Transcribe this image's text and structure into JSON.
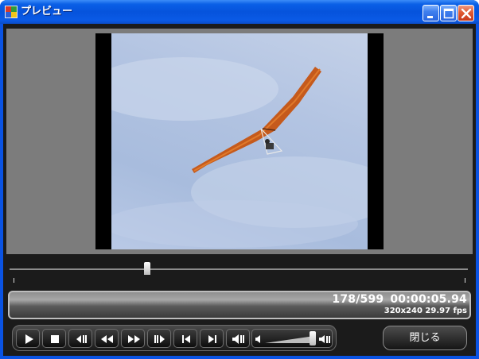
{
  "window": {
    "title": "プレビュー",
    "colors": {
      "titlebar": "#0653dc",
      "close_button": "#e05a32",
      "client_bg": "#1b1b1b",
      "preview_bg": "#7c7c7c"
    },
    "controls": {
      "minimize_icon": "minimize-icon",
      "maximize_icon": "maximize-icon",
      "close_icon": "close-icon"
    }
  },
  "playback": {
    "frame": "178/599",
    "timecode": "00:00:05.94",
    "video_info": "320x240 29.97 fps",
    "seek_position": 0.297,
    "volume_level": 0.78
  },
  "transport": {
    "buttons": [
      {
        "name": "play-button",
        "icon": "play-icon"
      },
      {
        "name": "stop-button",
        "icon": "stop-icon"
      },
      {
        "name": "step-back-button",
        "icon": "frame-back-icon"
      },
      {
        "name": "rewind-button",
        "icon": "rewind-icon"
      },
      {
        "name": "fast-forward-button",
        "icon": "fast-forward-icon"
      },
      {
        "name": "step-forward-button",
        "icon": "frame-forward-icon"
      },
      {
        "name": "go-to-start-button",
        "icon": "skip-start-icon"
      },
      {
        "name": "go-to-end-button",
        "icon": "skip-end-icon"
      },
      {
        "name": "mute-button",
        "icon": "speaker-icon"
      }
    ]
  },
  "close_button_label": "閉じる"
}
